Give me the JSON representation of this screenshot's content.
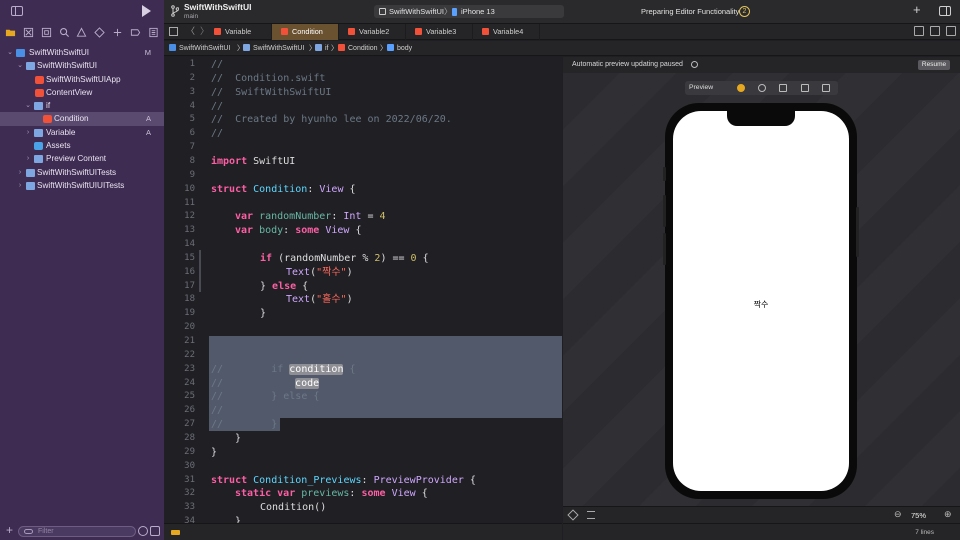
{
  "app": {
    "project_title": "SwiftWithSwiftUI",
    "branch": "main",
    "scheme": "SwiftWithSwiftUI",
    "device": "iPhone 13",
    "status": "Preparing Editor Functionality",
    "status_count": "2"
  },
  "sidebar": {
    "items": [
      {
        "label": "SwiftWithSwiftUI",
        "badge": "M",
        "kind": "project"
      },
      {
        "label": "SwiftWithSwiftUI",
        "badge": "",
        "kind": "folder"
      },
      {
        "label": "SwiftWithSwiftUIApp",
        "badge": "",
        "kind": "swift"
      },
      {
        "label": "ContentView",
        "badge": "",
        "kind": "swift"
      },
      {
        "label": "if",
        "badge": "",
        "kind": "folder"
      },
      {
        "label": "Condition",
        "badge": "A",
        "kind": "swift"
      },
      {
        "label": "Variable",
        "badge": "A",
        "kind": "folder"
      },
      {
        "label": "Assets",
        "badge": "",
        "kind": "assets"
      },
      {
        "label": "Preview Content",
        "badge": "",
        "kind": "folder"
      },
      {
        "label": "SwiftWithSwiftUITests",
        "badge": "",
        "kind": "folder"
      },
      {
        "label": "SwiftWithSwiftUIUITests",
        "badge": "",
        "kind": "folder"
      }
    ],
    "filter_placeholder": "Filter"
  },
  "tabs": [
    {
      "label": "Variable"
    },
    {
      "label": "Condition"
    },
    {
      "label": "Variable2"
    },
    {
      "label": "Variable3"
    },
    {
      "label": "Variable4"
    }
  ],
  "jumpbar": {
    "parts": [
      "SwiftWithSwiftUI",
      "SwiftWithSwiftUI",
      "if",
      "Condition",
      "body"
    ]
  },
  "code": {
    "lines": [
      {
        "n": "1"
      },
      {
        "n": "2"
      },
      {
        "n": "3"
      },
      {
        "n": "4"
      },
      {
        "n": "5"
      },
      {
        "n": "6"
      },
      {
        "n": "7"
      },
      {
        "n": "8"
      },
      {
        "n": "9"
      },
      {
        "n": "10"
      },
      {
        "n": "11"
      },
      {
        "n": "12"
      },
      {
        "n": "13"
      },
      {
        "n": "14"
      },
      {
        "n": "15"
      },
      {
        "n": "16"
      },
      {
        "n": "17"
      },
      {
        "n": "18"
      },
      {
        "n": "19"
      },
      {
        "n": "20"
      },
      {
        "n": "21"
      },
      {
        "n": "22"
      },
      {
        "n": "23"
      },
      {
        "n": "24"
      },
      {
        "n": "25"
      },
      {
        "n": "26"
      },
      {
        "n": "27"
      },
      {
        "n": "28"
      },
      {
        "n": "29"
      },
      {
        "n": "30"
      },
      {
        "n": "31"
      },
      {
        "n": "32"
      },
      {
        "n": "33"
      },
      {
        "n": "34"
      }
    ],
    "t": {
      "c1": "//",
      "c2": "//  Condition.swift",
      "c3": "//  SwiftWithSwiftUI",
      "c4": "//",
      "c5": "//  Created by hyunho lee on 2022/06/20.",
      "c6": "//",
      "import_kw": "import",
      "import_mod": " SwiftUI",
      "struct_kw": "struct",
      "struct_name": " Condition",
      "colon_view": ": ",
      "view": "View",
      "brace_open": " {",
      "var_kw": "var",
      "random": " randomNumber",
      "colon": ": ",
      "int": "Int",
      "eq": " = ",
      "four": "4",
      "body": " body",
      "some_kw": "some",
      "sp": " ",
      "if_kw": "if",
      "cond_open": " (randomNumber % ",
      "two": "2",
      "cond_close": ") == ",
      "zero": "0",
      "text_fn": "Text",
      "paren_open": "(",
      "str_even": "\"짝수\"",
      "str_odd": "\"홀수\"",
      "paren_close": ")",
      "close_else": "} ",
      "else_kw": "else",
      "close": "}",
      "cm_slash": "//",
      "cm_if": "        if ",
      "cm_condition": "condition",
      "cm_brace": " {",
      "cm_code": "code",
      "cm_else": "        } else {",
      "cm_close": "        }",
      "preview_struct": " Condition_Previews",
      "preview_provider": "PreviewProvider",
      "static_kw": "static",
      "previews": " previews",
      "cond_call": "Condition()"
    }
  },
  "preview": {
    "message": "Automatic preview updating paused",
    "resume_label": "Resume",
    "toolbar_label": "Preview",
    "phone_text": "짝수",
    "zoom": "75%",
    "lines_info": "7 lines"
  }
}
